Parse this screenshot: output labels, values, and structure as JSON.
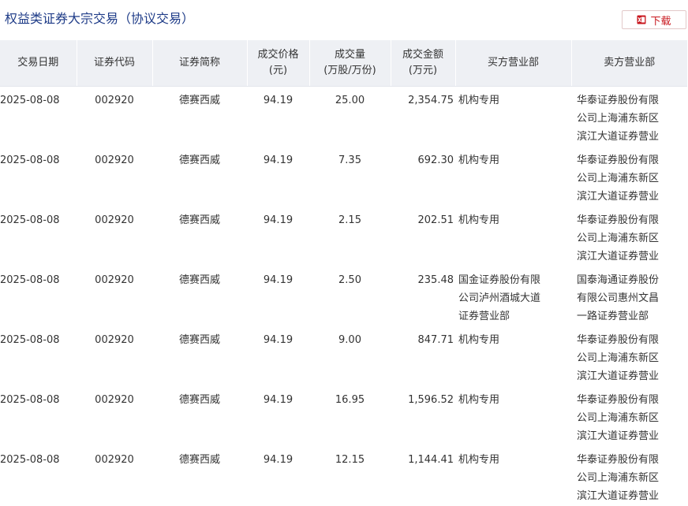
{
  "page": {
    "title": "权益类证券大宗交易（协议交易）",
    "download_label": "下载"
  },
  "colors": {
    "title": "#1f3c88",
    "accent": "#c8161d",
    "header_bg": "#eef0f4"
  },
  "table": {
    "headers": [
      {
        "key": "date",
        "label": "交易日期"
      },
      {
        "key": "code",
        "label": "证券代码"
      },
      {
        "key": "abbr",
        "label": "证券简称"
      },
      {
        "key": "price",
        "label": "成交价格\n(元)"
      },
      {
        "key": "vol",
        "label": "成交量\n(万股/万份)"
      },
      {
        "key": "amt",
        "label": "成交金额\n(万元)"
      },
      {
        "key": "buyer",
        "label": "买方营业部"
      },
      {
        "key": "seller",
        "label": "卖方营业部"
      }
    ],
    "rows": [
      {
        "date": "2025-08-08",
        "code": "002920",
        "abbr": "德赛西威",
        "price": "94.19",
        "vol": "25.00",
        "amt": "2,354.75",
        "buyer": "机构专用",
        "seller": "华泰证券股份有限公司上海浦东新区滨江大道证券营业部"
      },
      {
        "date": "2025-08-08",
        "code": "002920",
        "abbr": "德赛西威",
        "price": "94.19",
        "vol": "7.35",
        "amt": "692.30",
        "buyer": "机构专用",
        "seller": "华泰证券股份有限公司上海浦东新区滨江大道证券营业部"
      },
      {
        "date": "2025-08-08",
        "code": "002920",
        "abbr": "德赛西威",
        "price": "94.19",
        "vol": "2.15",
        "amt": "202.51",
        "buyer": "机构专用",
        "seller": "华泰证券股份有限公司上海浦东新区滨江大道证券营业部"
      },
      {
        "date": "2025-08-08",
        "code": "002920",
        "abbr": "德赛西威",
        "price": "94.19",
        "vol": "2.50",
        "amt": "235.48",
        "buyer": "国金证券股份有限公司泸州酒城大道证券营业部",
        "seller": "国泰海通证券股份有限公司惠州文昌一路证券营业部"
      },
      {
        "date": "2025-08-08",
        "code": "002920",
        "abbr": "德赛西威",
        "price": "94.19",
        "vol": "9.00",
        "amt": "847.71",
        "buyer": "机构专用",
        "seller": "华泰证券股份有限公司上海浦东新区滨江大道证券营业部"
      },
      {
        "date": "2025-08-08",
        "code": "002920",
        "abbr": "德赛西威",
        "price": "94.19",
        "vol": "16.95",
        "amt": "1,596.52",
        "buyer": "机构专用",
        "seller": "华泰证券股份有限公司上海浦东新区滨江大道证券营业部"
      },
      {
        "date": "2025-08-08",
        "code": "002920",
        "abbr": "德赛西威",
        "price": "94.19",
        "vol": "12.15",
        "amt": "1,144.41",
        "buyer": "机构专用",
        "seller": "华泰证券股份有限公司上海浦东新区滨江大道证券营业部"
      }
    ]
  }
}
